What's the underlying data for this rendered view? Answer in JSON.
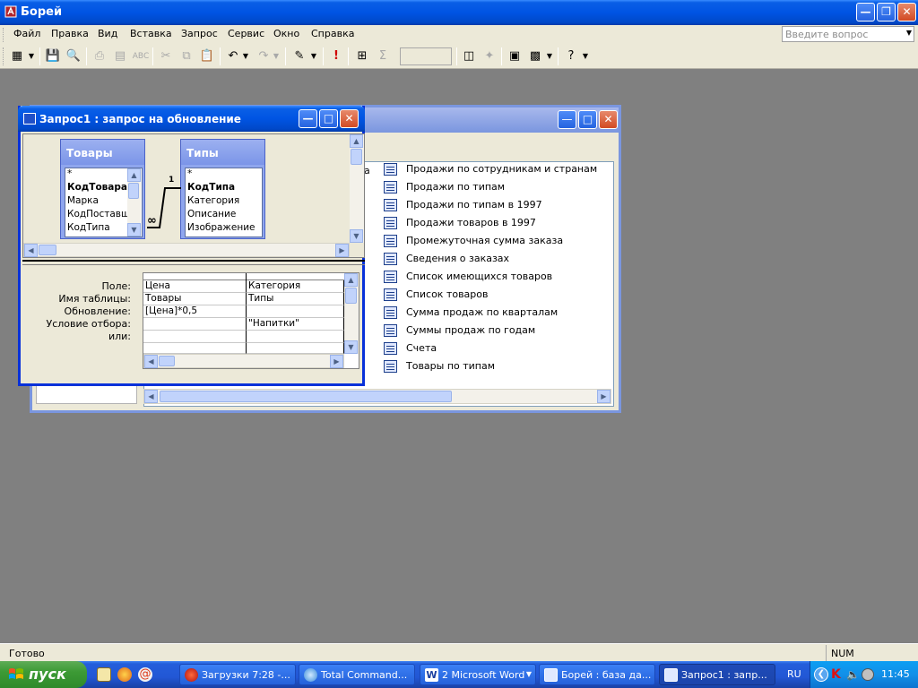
{
  "app": {
    "title": "Борей",
    "colors": {
      "titlebar": "#0054e3",
      "dialog_bg": "#ece9d8",
      "mdi_bg": "#808080",
      "start_green": "#3c9a35"
    }
  },
  "menu": {
    "items": [
      "Файл",
      "Правка",
      "Вид",
      "Вставка",
      "Запрос",
      "Сервис",
      "Окно",
      "Справка"
    ],
    "ask_placeholder": "Введите вопрос"
  },
  "toolbar": {
    "icons": [
      "view-icon",
      "save-icon",
      "print-preview-icon",
      "print-icon",
      "spellcheck-icon",
      "cut-icon",
      "copy-icon",
      "paste-icon",
      "undo-icon",
      "redo-icon",
      "query-type-icon",
      "run-icon",
      "show-table-icon",
      "totals-icon",
      "properties-icon",
      "build-icon",
      "database-window-icon",
      "new-object-icon",
      "help-icon"
    ]
  },
  "db_window": {
    "items": [
      "Продажи по сотрудникам и странам",
      "Продажи по типам",
      "Продажи по типам в 1997",
      "Продажи товаров в 1997",
      "Промежуточная сумма заказа",
      "Сведения о заказах",
      "Список имеющихся товаров",
      "Список товаров",
      "Сумма продаж по кварталам",
      "Суммы продаж по годам",
      "Счета",
      "Товары по типам"
    ],
    "partial_text": "а"
  },
  "query_window": {
    "title": "Запрос1 : запрос на обновление",
    "tables": [
      {
        "name": "Товары",
        "fields": [
          "*",
          "КодТовара",
          "Марка",
          "КодПоставщ",
          "КодТипа"
        ],
        "key_field": "КодТовара"
      },
      {
        "name": "Типы",
        "fields": [
          "*",
          "КодТипа",
          "Категория",
          "Описание",
          "Изображение"
        ],
        "key_field": "КодТипа"
      }
    ],
    "relationship": {
      "one_label": "1",
      "many_label": "∞"
    },
    "row_labels": [
      "Поле:",
      "Имя таблицы:",
      "Обновление:",
      "Условие отбора:",
      "или:"
    ],
    "columns": [
      {
        "field": "Цена",
        "table": "Товары",
        "update": "[Цена]*0,5",
        "criteria": "",
        "or": ""
      },
      {
        "field": "Категория",
        "table": "Типы",
        "update": "",
        "criteria": "\"Напитки\"",
        "or": ""
      }
    ]
  },
  "status": {
    "text": "Готово",
    "num": "NUM"
  },
  "taskbar": {
    "start_label": "пуск",
    "tasks": [
      {
        "label": "Загрузки 7:28 -...",
        "active": false
      },
      {
        "label": "Total Command...",
        "active": false
      },
      {
        "label": "2 Microsoft Word",
        "active": false
      },
      {
        "label": "Борей : база да...",
        "active": false
      },
      {
        "label": "Запрос1 : запр...",
        "active": true
      }
    ],
    "lang": "RU",
    "clock": "11:45"
  }
}
